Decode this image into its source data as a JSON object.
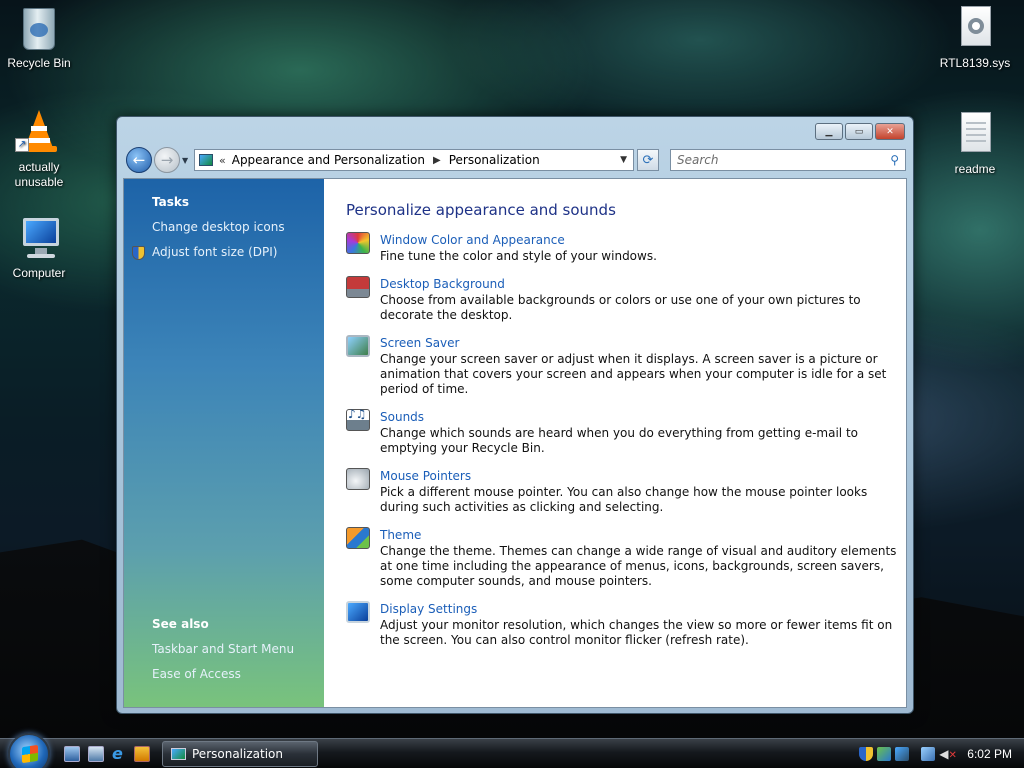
{
  "desktop": {
    "icons": [
      {
        "label": "Recycle Bin",
        "icon": "recycle-bin-icon"
      },
      {
        "label": "actually unusable",
        "icon": "vlc-cone-icon"
      },
      {
        "label": "Computer",
        "icon": "computer-icon"
      },
      {
        "label": "RTL8139.sys",
        "icon": "system-file-icon"
      },
      {
        "label": "readme",
        "icon": "text-file-icon"
      }
    ]
  },
  "window": {
    "breadcrumb": {
      "overflow": "«",
      "items": [
        "Appearance and Personalization",
        "Personalization"
      ]
    },
    "search": {
      "placeholder": "Search"
    },
    "left_pane": {
      "tasks_heading": "Tasks",
      "tasks": [
        "Change desktop icons",
        "Adjust font size (DPI)"
      ],
      "see_also_heading": "See also",
      "see_also": [
        "Taskbar and Start Menu",
        "Ease of Access"
      ]
    },
    "main": {
      "heading": "Personalize appearance and sounds",
      "items": [
        {
          "title": "Window Color and Appearance",
          "description": "Fine tune the color and style of your windows.",
          "icon": "color-palette-icon"
        },
        {
          "title": "Desktop Background",
          "description": "Choose from available backgrounds or colors or use one of your own pictures to decorate the desktop.",
          "icon": "desktop-background-icon"
        },
        {
          "title": "Screen Saver",
          "description": "Change your screen saver or adjust when it displays. A screen saver is a picture or animation that covers your screen and appears when your computer is idle for a set period of time.",
          "icon": "screen-saver-icon"
        },
        {
          "title": "Sounds",
          "description": "Change which sounds are heard when you do everything from getting e-mail to emptying your Recycle Bin.",
          "icon": "sounds-icon"
        },
        {
          "title": "Mouse Pointers",
          "description": "Pick a different mouse pointer. You can also change how the mouse pointer looks during such activities as clicking and selecting.",
          "icon": "mouse-icon"
        },
        {
          "title": "Theme",
          "description": "Change the theme. Themes can change a wide range of visual and auditory elements at one time including the appearance of menus, icons, backgrounds, screen savers, some computer sounds, and mouse pointers.",
          "icon": "theme-icon"
        },
        {
          "title": "Display Settings",
          "description": "Adjust your monitor resolution, which changes the view so more or fewer items fit on the screen. You can also control monitor flicker (refresh rate).",
          "icon": "display-icon"
        }
      ]
    }
  },
  "taskbar": {
    "active_task": "Personalization",
    "clock": "6:02 PM"
  }
}
